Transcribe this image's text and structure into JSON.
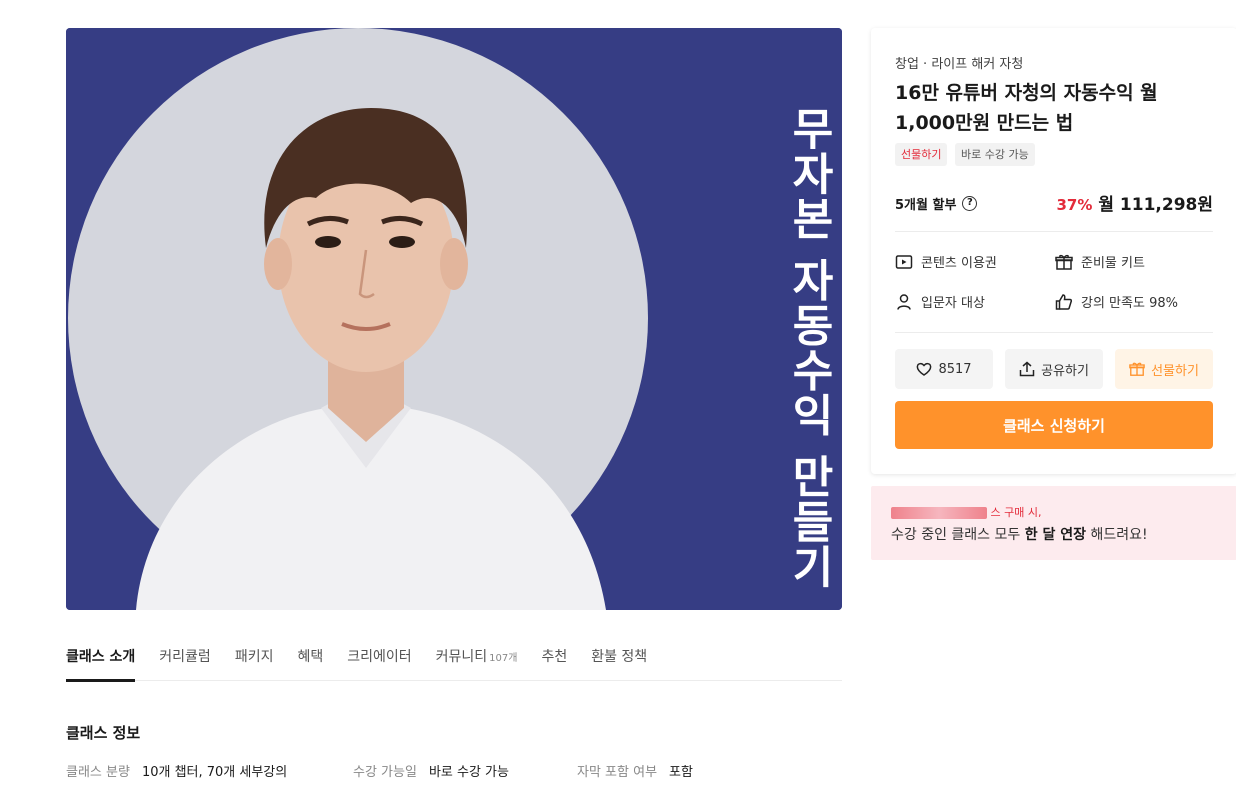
{
  "hero": {
    "title": "무자본 자동수익 만들기",
    "colors": {
      "background": "#363d84",
      "circle": "#d4d6dd",
      "shirt": "#f1f1f3",
      "hair": "#4a2f22",
      "skin": "#e9c3ac"
    }
  },
  "card": {
    "category": "창업 · 라이프 해커 자청",
    "title": "16만 유튜버 자청의 자동수익 월 1,000만원 만드는 법",
    "badges": [
      "선물하기",
      "바로 수강 가능"
    ],
    "installment_label": "5개월 할부",
    "help_icon": "?",
    "discount": "37%",
    "price": "월 111,298원",
    "features": [
      {
        "icon": "play-square-icon",
        "label": "콘텐츠 이용권"
      },
      {
        "icon": "gift-icon",
        "label": "준비물 키트"
      },
      {
        "icon": "person-icon",
        "label": "입문자 대상"
      },
      {
        "icon": "thumbs-up-icon",
        "label": "강의 만족도 98%"
      }
    ],
    "like_count": "8517",
    "share_label": "공유하기",
    "gift_label": "선물하기",
    "cta_label": "클래스 신청하기",
    "accent_color": "#ff922b",
    "red_color": "#e32b3a"
  },
  "promo": {
    "line1": "스 구매 시,",
    "line2_prefix": "수강 중인 클래스 모두 ",
    "line2_bold": "한 달 연장",
    "line2_suffix": " 해드려요!"
  },
  "tabs": [
    {
      "label": "클래스 소개",
      "active": true
    },
    {
      "label": "커리큘럼"
    },
    {
      "label": "패키지"
    },
    {
      "label": "혜택"
    },
    {
      "label": "크리에이터"
    },
    {
      "label": "커뮤니티",
      "count": "107개"
    },
    {
      "label": "추천"
    },
    {
      "label": "환불 정책"
    }
  ],
  "class_info": {
    "title": "클래스 정보",
    "rows": [
      {
        "key": "클래스 분량",
        "value": "10개 챕터, 70개 세부강의"
      },
      {
        "key": "수강 가능일",
        "value": "바로 수강 가능"
      },
      {
        "key": "자막 포함 여부",
        "value": "포함"
      }
    ]
  }
}
